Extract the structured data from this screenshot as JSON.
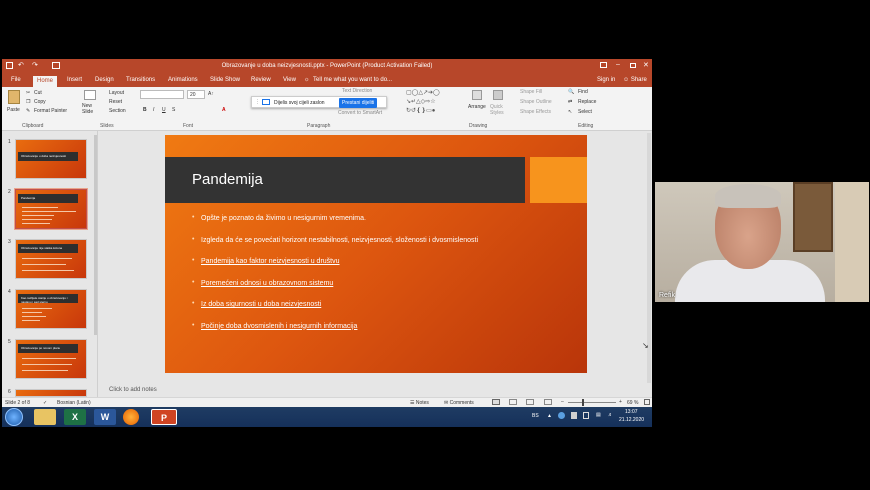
{
  "window": {
    "title": "Obrazovanje u doba neizvjesnosti.pptx - PowerPoint (Product Activation Failed)"
  },
  "tabs": [
    {
      "label": "File"
    },
    {
      "label": "Home"
    },
    {
      "label": "Insert"
    },
    {
      "label": "Design"
    },
    {
      "label": "Transitions"
    },
    {
      "label": "Animations"
    },
    {
      "label": "Slide Show"
    },
    {
      "label": "Review"
    },
    {
      "label": "View"
    }
  ],
  "tell_me": "Tell me what you want to do...",
  "sign_in": "Sign in",
  "share": "Share",
  "ribbon": {
    "paste": "Paste",
    "cut": "Cut",
    "copy": "Copy",
    "format_painter": "Format Painter",
    "new_slide": "New Slide",
    "layout": "Layout",
    "reset": "Reset",
    "section": "Section",
    "font_size": "20",
    "text_direction": "Text Direction",
    "convert_smartart": "Convert to SmartArt",
    "arrange": "Arrange",
    "quick_styles": "Quick Styles",
    "shape_fill": "Shape Fill",
    "shape_outline": "Shape Outline",
    "shape_effects": "Shape Effects",
    "find": "Find",
    "replace": "Replace",
    "select": "Select",
    "groups": {
      "clipboard": "Clipboard",
      "slides": "Slides",
      "font": "Font",
      "paragraph": "Paragraph",
      "drawing": "Drawing",
      "editing": "Editing"
    }
  },
  "share_bar": {
    "text": "Dijelis svoj cijeli zaslon",
    "stop": "Prestani dijeliti"
  },
  "thumbnails": [
    {
      "num": "1",
      "title": "Obrazovanje u doba neizvjesnosti"
    },
    {
      "num": "2",
      "title": "Pandemija"
    },
    {
      "num": "3",
      "title": "Obrazovanje nije statka kolona"
    },
    {
      "num": "4",
      "title": "Kao razlijele starije u obrazovanju i nastavu i sad sterno"
    },
    {
      "num": "5",
      "title": "Obrazovanje po novom planu"
    },
    {
      "num": "6",
      "title": ""
    }
  ],
  "slide": {
    "title": "Pandemija",
    "bullets": [
      "Opšte je poznato da živimo u nesigurnim vremenima.",
      "Izgleda da će se povećati horizont nestabilnosti, neizvjesnosti, složenosti i dvosmislenosti",
      "Pandemija kao faktor neizvjesnosti u društvu",
      "Poremećeni odnosi u obrazovnom sistemu",
      "Iz doba sigurnosti u doba neizvjesnosti",
      "Počinje doba dvosmislenih i nesigurnih informacija"
    ]
  },
  "notes_placeholder": "Click to add notes",
  "status": {
    "slide_info": "Slide 2 of 8",
    "language": "Bosnian (Latin)",
    "notes": "Notes",
    "comments": "Comments",
    "zoom": "69 %"
  },
  "taskbar": {
    "lang": "BS",
    "time": "13:07",
    "date": "21.12.2020"
  },
  "webcam": {
    "participant": "Refik"
  },
  "colors": {
    "ppt_red": "#b7472a",
    "slide_orange": "#e8650f",
    "share_blue": "#1a73e8"
  }
}
